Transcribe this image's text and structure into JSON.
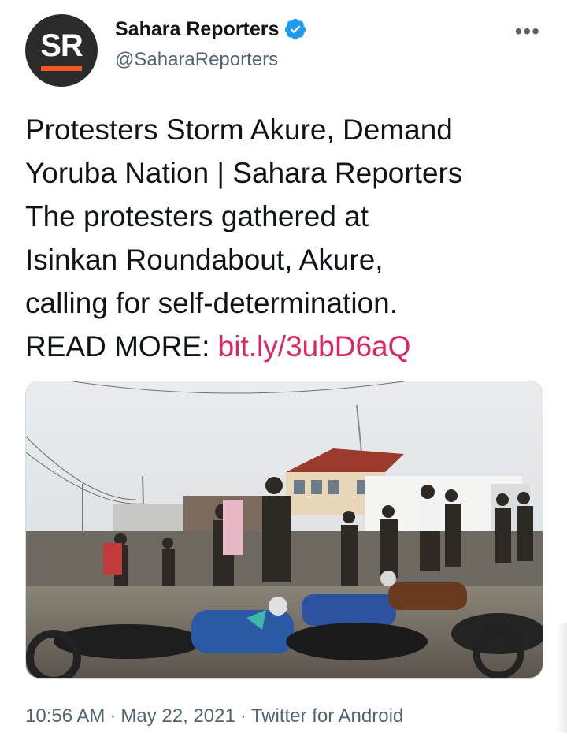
{
  "author": {
    "avatar_initials": "SR",
    "display_name": "Sahara Reporters",
    "handle": "@SaharaReporters",
    "verified": true
  },
  "menu_icon": "more-horizontal-icon",
  "tweet": {
    "lines": [
      "Protesters Storm Akure, Demand",
      "Yoruba Nation | Sahara Reporters",
      "The protesters gathered at",
      "Isinkan Roundabout, Akure,",
      "calling for self-determination."
    ],
    "read_more_label": "READ MORE: ",
    "link_text": "bit.ly/3ubD6aQ"
  },
  "media": {
    "alt": "Protesters gathered with motorcycles at a roundabout"
  },
  "meta": {
    "time": "10:56 AM",
    "date": "May 22, 2021",
    "source": "Twitter for Android"
  },
  "colors": {
    "link": "#e0245e",
    "verified": "#1d9bf0",
    "secondary_text": "#536471",
    "avatar_bg": "#2b2b2b",
    "avatar_accent": "#f15a24"
  }
}
